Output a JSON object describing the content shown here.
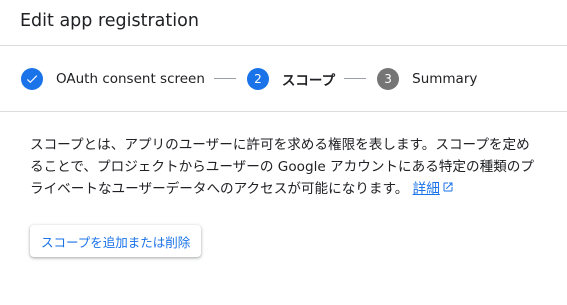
{
  "header": {
    "title": "Edit app registration"
  },
  "stepper": {
    "steps": [
      {
        "number": "1",
        "label": "OAuth consent screen",
        "state": "done",
        "icon": "check-icon"
      },
      {
        "number": "2",
        "label": "スコープ",
        "state": "active"
      },
      {
        "number": "3",
        "label": "Summary",
        "state": "pending"
      }
    ]
  },
  "content": {
    "description": "スコープとは、アプリのユーザーに許可を求める権限を表します。スコープを定めることで、プロジェクトからユーザーの Google アカウントにある特定の種類のプライベートなユーザーデータへのアクセスが可能になります。",
    "learn_more_label": "詳細",
    "learn_more_icon": "open-in-new-icon",
    "add_button_label": "スコープを追加または削除"
  },
  "colors": {
    "accent": "#1a73e8",
    "pending_step": "#757575",
    "divider": "#dadce0",
    "text": "#202124"
  }
}
